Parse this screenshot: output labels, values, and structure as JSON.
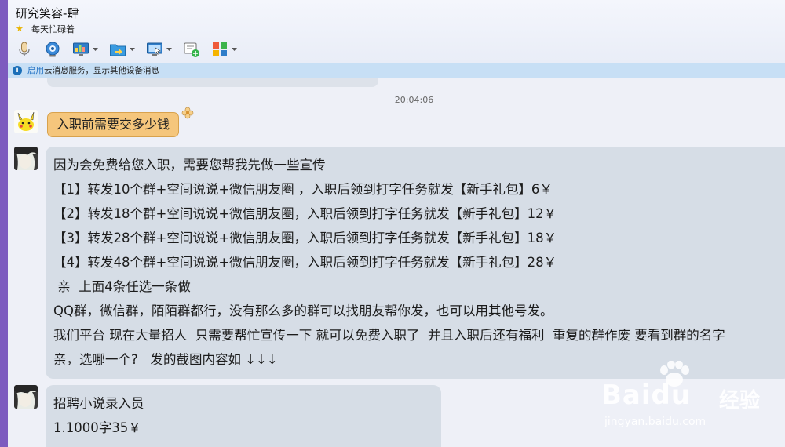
{
  "header": {
    "title": "研究笑容-肆",
    "status_icon": "star-icon",
    "status_text": "每天忙碌着"
  },
  "toolbar": {
    "buttons": [
      {
        "icon": "microphone-icon"
      },
      {
        "icon": "webcam-icon"
      },
      {
        "icon": "screen-share-icon"
      },
      {
        "icon": "folder-transfer-icon"
      },
      {
        "icon": "remote-desktop-icon"
      },
      {
        "icon": "new-message-icon"
      },
      {
        "icon": "apps-grid-icon"
      }
    ]
  },
  "info_bar": {
    "link": "启用",
    "text": "云消息服务，显示其他设备消息"
  },
  "chat": {
    "timestamp": "20:04:06",
    "messages": {
      "outgoing_1": "入职前需要交多少钱",
      "incoming_1": [
        "因为会免费给您入职，需要您帮我先做一些宣传",
        "【1】转发10个群+空间说说+微信朋友圈 ，入职后领到打字任务就发【新手礼包】6￥",
        "【2】转发18个群+空间说说+微信朋友圈，入职后领到打字任务就发【新手礼包】12￥",
        "【3】转发28个群+空间说说+微信朋友圈，入职后领到打字任务就发【新手礼包】18￥",
        "【4】转发48个群+空间说说+微信朋友圈，入职后领到打字任务就发【新手礼包】28￥",
        " 亲  上面4条任选一条做",
        "QQ群，微信群，陌陌群都行，没有那么多的群可以找朋友帮你发，也可以用其他号发。",
        "我们平台 现在大量招人  只需要帮忙宣传一下 就可以免费入职了  并且入职后还有福利  重复的群作废 要看到群的名字",
        "亲，选哪一个?   发的截图内容如 ↓↓↓"
      ],
      "incoming_2": [
        "招聘小说录入员",
        "1.1000字35￥"
      ]
    }
  },
  "watermark": {
    "brand": "Baidu",
    "product": "经验",
    "url": "jingyan.baidu.com"
  },
  "colors": {
    "accent_purple": "#7d5bbf",
    "info_bar": "#c7dff5",
    "incoming_bubble": "#d6dde6",
    "outgoing_bubble": "#f5c67c"
  }
}
